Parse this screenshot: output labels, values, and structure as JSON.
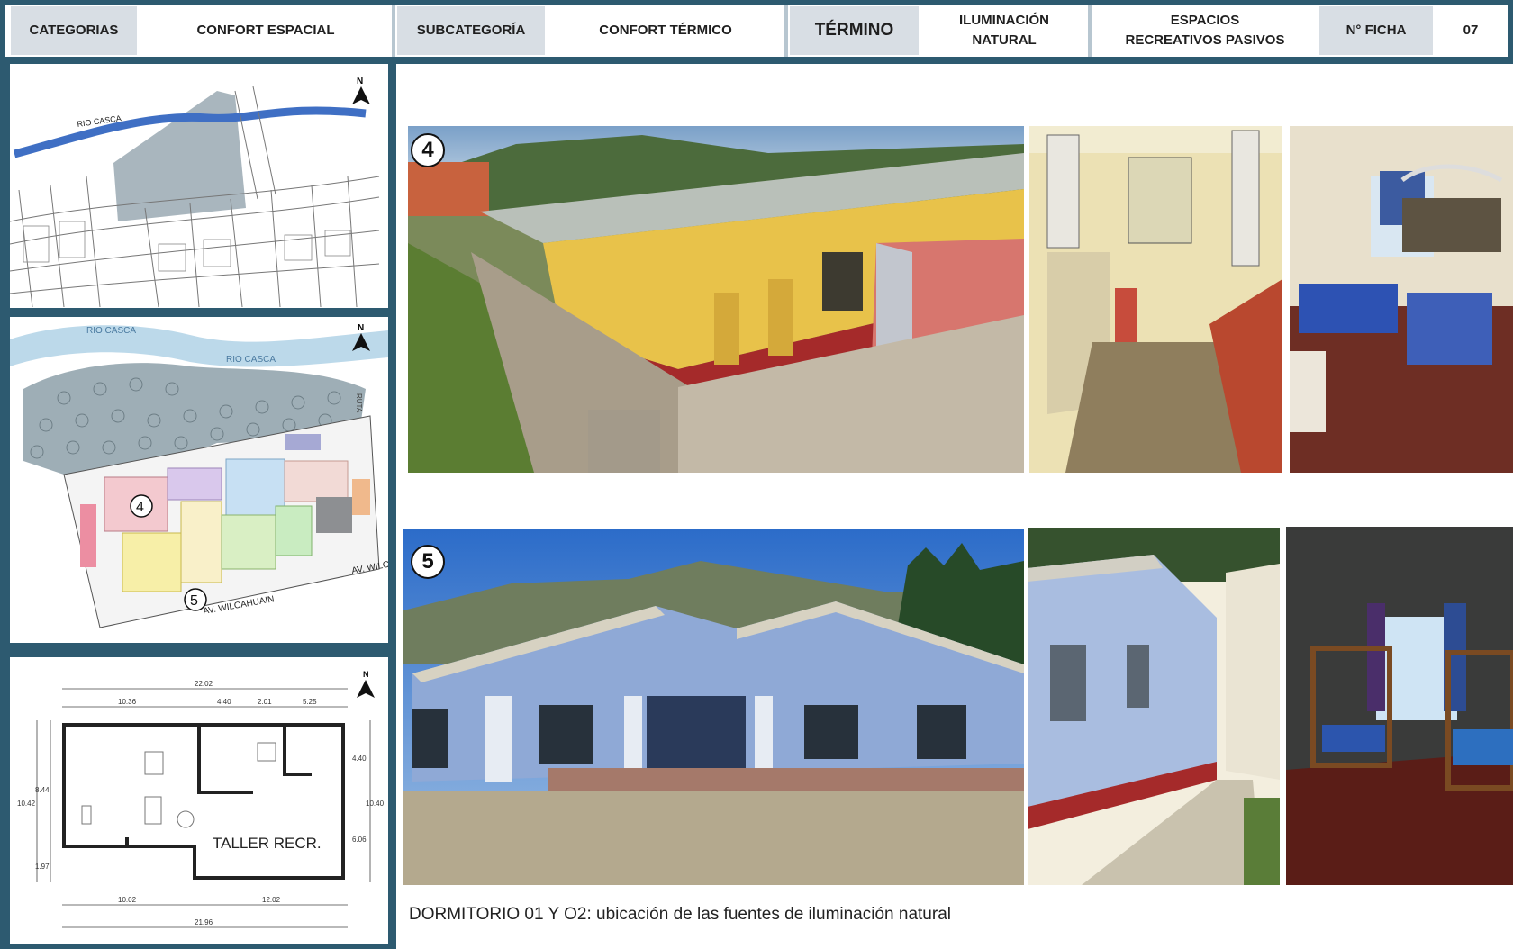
{
  "header": {
    "categorias_label": "CATEGORIAS",
    "categorias_value": "CONFORT ESPACIAL",
    "subcategoria_label": "SUBCATEGORÍA",
    "subcategoria_value": "CONFORT TÉRMICO",
    "termino_label": "TÉRMINO",
    "termino_value_1": "ILUMINACIÓN",
    "termino_value_2": "NATURAL",
    "espacios_1": "ESPACIOS",
    "espacios_2": "RECREATIVOS PASIVOS",
    "ficha_label": "N° FICHA",
    "ficha_value": "07"
  },
  "map1": {
    "river": "RIO CASCA",
    "north": "N"
  },
  "map2": {
    "river1": "RIO CASCA",
    "river2": "RIO CASCA",
    "avenue1": "AV. WILCAHUAIN",
    "avenue2": "AV. WILC",
    "marker4": "4",
    "marker5": "5",
    "north": "N",
    "side_label": "RUTA"
  },
  "plan": {
    "north": "N",
    "room_label": "TALLER RECR.",
    "dims_top": [
      "22.02",
      "10.36",
      "4.40",
      "2.01",
      "5.25"
    ],
    "dims_left": [
      "10.42",
      "8.44",
      "1.97"
    ],
    "dims_right": [
      "4.40",
      "10.40",
      "6.06"
    ],
    "dims_bottom": [
      "10.02",
      "12.02",
      "21.96"
    ]
  },
  "photos": {
    "label_row1": "4",
    "label_row2": "5"
  },
  "caption": "DORMITORIO 01 Y O2: ubicación de las fuentes  de iluminación natural",
  "colors": {
    "frame": "#2d5a70",
    "header_gray": "#d8dee4",
    "wall_yellow": "#e8c24a",
    "wall_blue": "#8fa9d6",
    "trim_red": "#a52a2a"
  }
}
